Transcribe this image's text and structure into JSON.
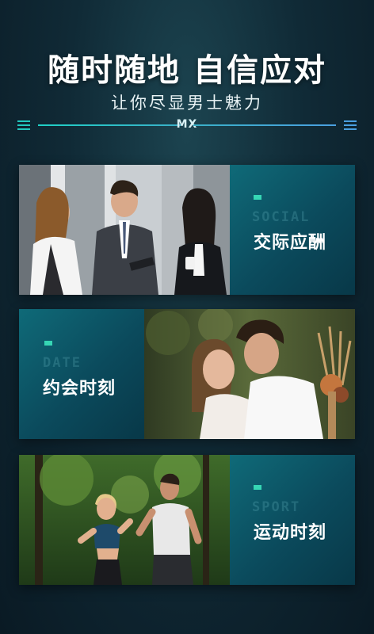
{
  "header": {
    "title": "随时随地 自信应对",
    "subtitle": "让你尽显男士魅力",
    "divider_text": "MX"
  },
  "cards": [
    {
      "ghost": "SOCIAL",
      "label": "交际应酬",
      "image": "business-people-photo"
    },
    {
      "ghost": "DATE",
      "label": "约会时刻",
      "image": "couple-photo"
    },
    {
      "ghost": "SPORT",
      "label": "运动时刻",
      "image": "jogging-photo"
    }
  ],
  "colors": {
    "accent": "#36d6b4",
    "panel": "#0b4a5c",
    "background": "#102a36",
    "line_left": "#1fd0c6",
    "line_right": "#4aa0e0"
  }
}
